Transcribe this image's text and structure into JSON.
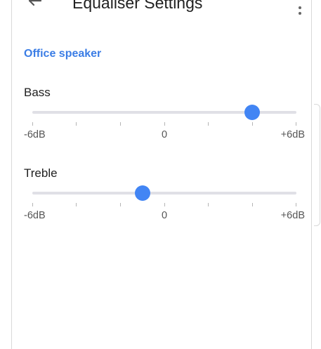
{
  "header": {
    "title": "Equaliser Settings",
    "back_icon": "arrow-back-icon",
    "menu_icon": "more-vert-icon"
  },
  "device": {
    "name": "Office speaker"
  },
  "sliders": [
    {
      "label": "Bass",
      "min_label": "-6dB",
      "mid_label": "0",
      "max_label": "+6dB",
      "min": -6,
      "max": 6,
      "value": 4
    },
    {
      "label": "Treble",
      "min_label": "-6dB",
      "mid_label": "0",
      "max_label": "+6dB",
      "min": -6,
      "max": 6,
      "value": -1
    }
  ],
  "colors": {
    "accent": "#4285f4",
    "section_title": "#3b7de5",
    "track": "#e0e0e6"
  }
}
